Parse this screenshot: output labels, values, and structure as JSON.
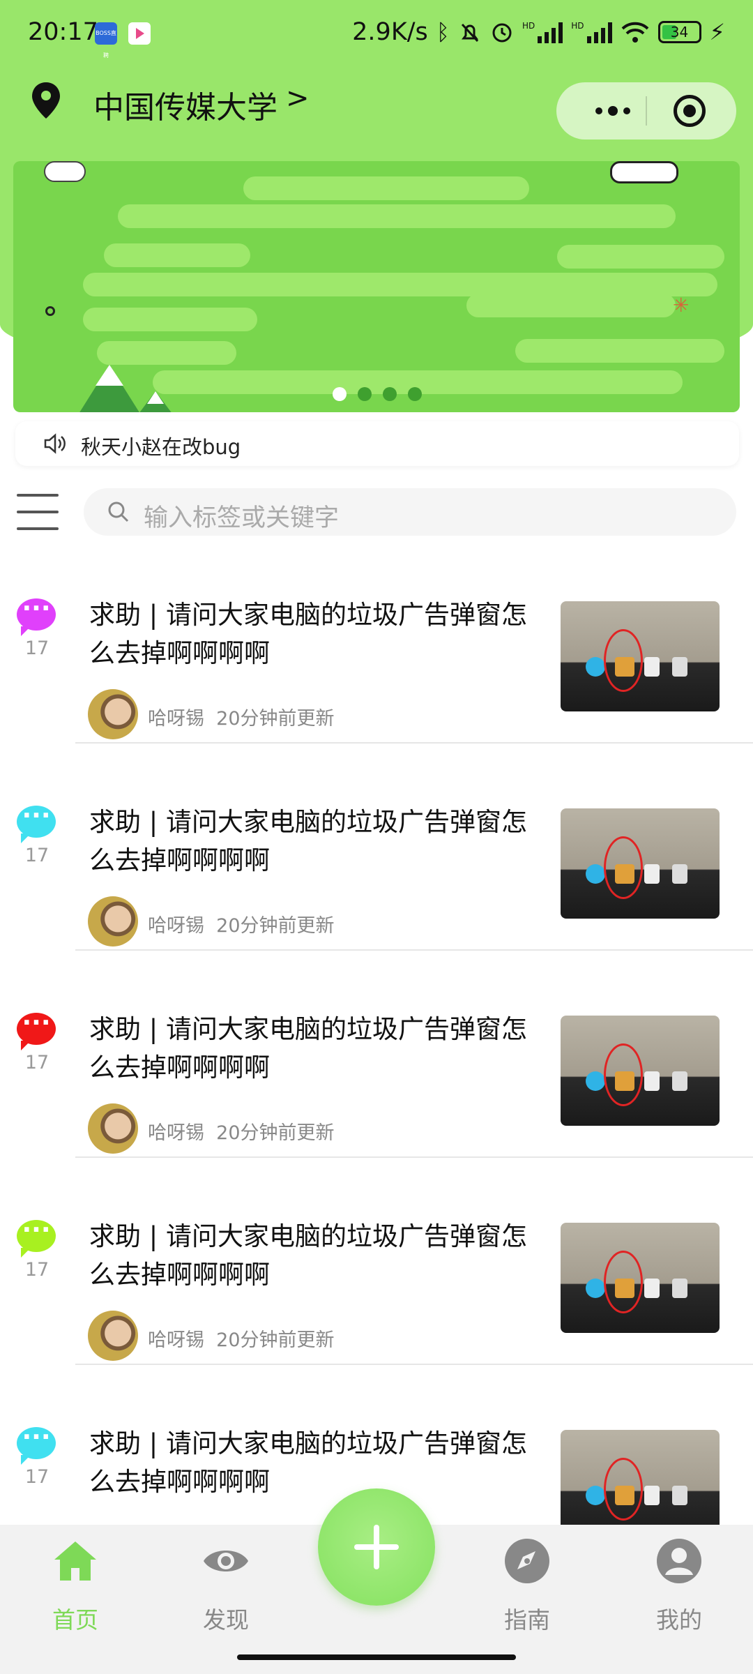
{
  "status_bar": {
    "time": "20:17",
    "app1_label": "BOSS直聘",
    "net_speed": "2.9K/s",
    "sig1_label": "HD",
    "sig2_label": "HD",
    "battery": "34"
  },
  "header": {
    "location": "中国传媒大学",
    "chevron": ">"
  },
  "notice": {
    "text": "秋天小赵在改bug"
  },
  "search": {
    "placeholder": "输入标签或关键字"
  },
  "colors": {
    "theme_green": "#99e66a",
    "active_tab": "#7ed957",
    "bubble_colors": [
      "#e040fb",
      "#40e0f0",
      "#f01818",
      "#a8f020",
      "#40e0f0"
    ]
  },
  "posts": [
    {
      "title": "求助 | 请问大家电脑的垃圾广告弹窗怎么去掉啊啊啊啊",
      "count": "17",
      "author": "哈呀锡",
      "updated": "20分钟前更新"
    },
    {
      "title": "求助 | 请问大家电脑的垃圾广告弹窗怎么去掉啊啊啊啊",
      "count": "17",
      "author": "哈呀锡",
      "updated": "20分钟前更新"
    },
    {
      "title": "求助 | 请问大家电脑的垃圾广告弹窗怎么去掉啊啊啊啊",
      "count": "17",
      "author": "哈呀锡",
      "updated": "20分钟前更新"
    },
    {
      "title": "求助 | 请问大家电脑的垃圾广告弹窗怎么去掉啊啊啊啊",
      "count": "17",
      "author": "哈呀锡",
      "updated": "20分钟前更新"
    },
    {
      "title": "求助 | 请问大家电脑的垃圾广告弹窗怎么去掉啊啊啊啊",
      "count": "17",
      "author": "",
      "updated": ""
    }
  ],
  "tabs": [
    {
      "label": "首页",
      "icon": "home-icon",
      "active": true
    },
    {
      "label": "发现",
      "icon": "eye-icon",
      "active": false
    },
    {
      "label": "指南",
      "icon": "compass-icon",
      "active": false
    },
    {
      "label": "我的",
      "icon": "user-icon",
      "active": false
    }
  ]
}
